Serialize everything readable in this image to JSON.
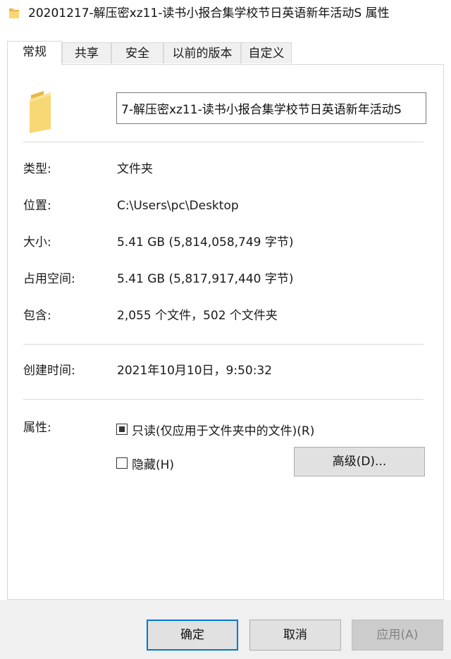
{
  "window": {
    "title": "20201217-解压密xz11-读书小报合集学校节日英语新年活动S 属性"
  },
  "tabs": [
    {
      "label": "常规",
      "active": true
    },
    {
      "label": "共享",
      "active": false
    },
    {
      "label": "安全",
      "active": false
    },
    {
      "label": "以前的版本",
      "active": false
    },
    {
      "label": "自定义",
      "active": false
    }
  ],
  "general": {
    "name_value": "7-解压密xz11-读书小报合集学校节日英语新年活动S",
    "type_label": "类型:",
    "type_value": "文件夹",
    "location_label": "位置:",
    "location_value": "C:\\Users\\pc\\Desktop",
    "size_label": "大小:",
    "size_value": "5.41 GB (5,814,058,749 字节)",
    "size_on_disk_label": "占用空间:",
    "size_on_disk_value": "5.41 GB (5,817,917,440 字节)",
    "contains_label": "包含:",
    "contains_value": "2,055 个文件，502 个文件夹",
    "created_label": "创建时间:",
    "created_value": "2021年10月10日，9:50:32",
    "attributes_label": "属性:",
    "readonly_label": "只读(仅应用于文件夹中的文件)(R)",
    "readonly_state": "indeterminate",
    "hidden_label": "隐藏(H)",
    "hidden_state": "unchecked",
    "advanced_label": "高级(D)..."
  },
  "footer": {
    "ok_label": "确定",
    "cancel_label": "取消",
    "apply_label": "应用(A)"
  },
  "colors": {
    "folder_yellow": "#f8d775",
    "folder_dark": "#e8b84a",
    "focus_blue": "#0078d7"
  }
}
